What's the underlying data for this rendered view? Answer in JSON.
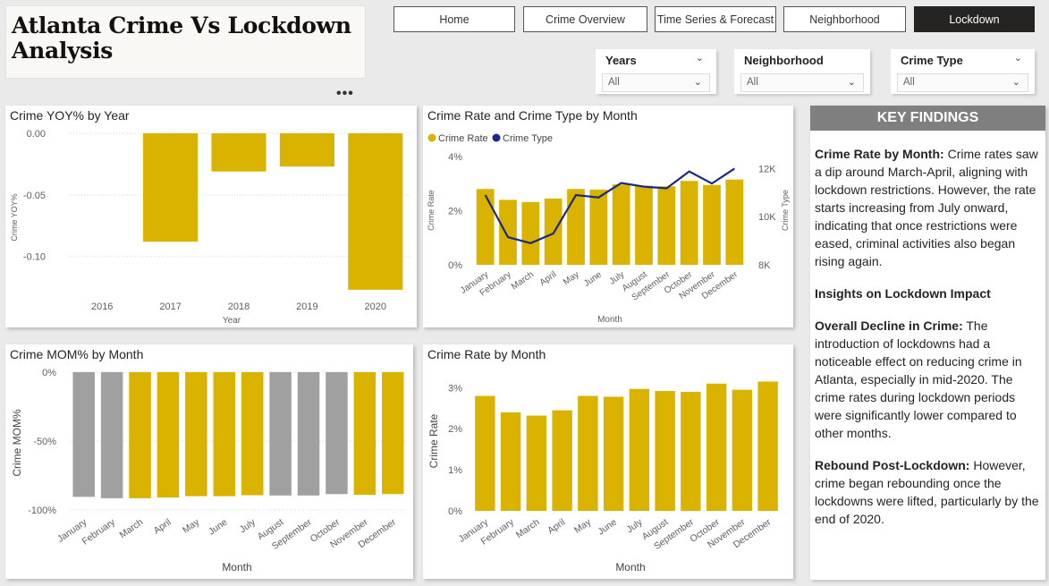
{
  "header": {
    "title": "Atlanta Crime Vs Lockdown Analysis",
    "more_icon": "•••"
  },
  "nav": [
    {
      "label": "Home",
      "active": false
    },
    {
      "label": "Crime Overview",
      "active": false
    },
    {
      "label": "Time Series & Forecast",
      "active": false
    },
    {
      "label": "Neighborhood",
      "active": false
    },
    {
      "label": "Lockdown",
      "active": true
    }
  ],
  "slicers": [
    {
      "label": "Years",
      "value": "All"
    },
    {
      "label": "Neighborhood",
      "value": "All"
    },
    {
      "label": "Crime Type",
      "value": "All"
    }
  ],
  "colors": {
    "gold": "#d9b300",
    "gray": "#a0a0a0",
    "navy": "#1a2a82",
    "nav_active": "#252423",
    "findings_header": "#7f7f7f"
  },
  "charts": {
    "yoy": {
      "title": "Crime YOY% by Year"
    },
    "rate_type": {
      "title": "Crime Rate and Crime Type by Month"
    },
    "mom": {
      "title": "Crime MOM% by Month"
    },
    "rate": {
      "title": "Crime Rate by Month"
    }
  },
  "chart_data": [
    {
      "type": "bar",
      "title": "Crime YOY% by Year",
      "xlabel": "Year",
      "ylabel": "Crime YOY%",
      "categories": [
        "2016",
        "2017",
        "2018",
        "2019",
        "2020"
      ],
      "values": [
        null,
        -0.088,
        -0.031,
        -0.027,
        -0.127
      ],
      "ylim": [
        -0.13,
        0
      ],
      "yticks": [
        "0.00",
        "-0.05",
        "-0.10"
      ],
      "grid": true
    },
    {
      "type": "bar",
      "title": "Crime Rate and Crime Type by Month",
      "xlabel": "Month",
      "ylabel": "Crime Rate",
      "y2label": "Crime Type",
      "categories": [
        "January",
        "February",
        "March",
        "April",
        "May",
        "June",
        "July",
        "August",
        "September",
        "October",
        "November",
        "December"
      ],
      "series": [
        {
          "name": "Crime Rate",
          "type": "bar",
          "values": [
            2.8,
            2.4,
            2.32,
            2.45,
            2.8,
            2.78,
            2.97,
            2.92,
            2.9,
            3.1,
            2.95,
            3.15
          ]
        },
        {
          "name": "Crime Type",
          "type": "line",
          "axis": "secondary",
          "values": [
            10900,
            9150,
            8900,
            9300,
            10900,
            10800,
            11400,
            11250,
            11180,
            11880,
            11380,
            12000
          ]
        }
      ],
      "ylim": [
        0,
        4
      ],
      "yticks": [
        "0%",
        "2%",
        "4%"
      ],
      "y2lim": [
        8000,
        12500
      ],
      "y2ticks": [
        "8K",
        "10K",
        "12K"
      ],
      "legend": "top-left"
    },
    {
      "type": "bar",
      "title": "Crime MOM% by Month",
      "xlabel": "Month",
      "ylabel": "Crime MOM%",
      "categories": [
        "January",
        "February",
        "March",
        "April",
        "May",
        "June",
        "July",
        "August",
        "September",
        "October",
        "November",
        "December"
      ],
      "values": [
        -90.5,
        -91.5,
        -91.5,
        -91,
        -90,
        -90,
        -89.3,
        -89.5,
        -89.5,
        -88.5,
        -89,
        -88.5
      ],
      "highlight": [
        false,
        false,
        true,
        true,
        true,
        true,
        true,
        false,
        false,
        false,
        true,
        true
      ],
      "ylim": [
        -100,
        0
      ],
      "yticks": [
        "0%",
        "-50%",
        "-100%"
      ],
      "grid": true
    },
    {
      "type": "bar",
      "title": "Crime Rate by Month",
      "xlabel": "Month",
      "ylabel": "Crime Rate",
      "categories": [
        "January",
        "February",
        "March",
        "April",
        "May",
        "June",
        "July",
        "August",
        "September",
        "October",
        "November",
        "December"
      ],
      "values": [
        2.8,
        2.4,
        2.32,
        2.45,
        2.8,
        2.78,
        2.97,
        2.92,
        2.9,
        3.1,
        2.95,
        3.15
      ],
      "ylim": [
        0,
        3.4
      ],
      "yticks": [
        "0%",
        "1%",
        "2%",
        "3%"
      ]
    }
  ],
  "findings": {
    "title": "KEY FINDINGS",
    "p1_head": "Crime Rate by Month:",
    "p1_body": "Crime rates saw a dip around March-April, aligning with lockdown restrictions. However, the rate starts increasing from July onward, indicating that once restrictions were eased, criminal activities also began rising again.",
    "p2_head": "Insights on Lockdown Impact",
    "p3_head": "Overall Decline in Crime:",
    "p3_body": "The introduction of lockdowns had a noticeable effect on reducing crime in Atlanta, especially in mid-2020. The crime rates during lockdown periods were significantly lower compared to other months.",
    "p4_head": "Rebound Post-Lockdown:",
    "p4_body": "However, crime began rebounding once the lockdowns were lifted, particularly by the end of 2020."
  }
}
